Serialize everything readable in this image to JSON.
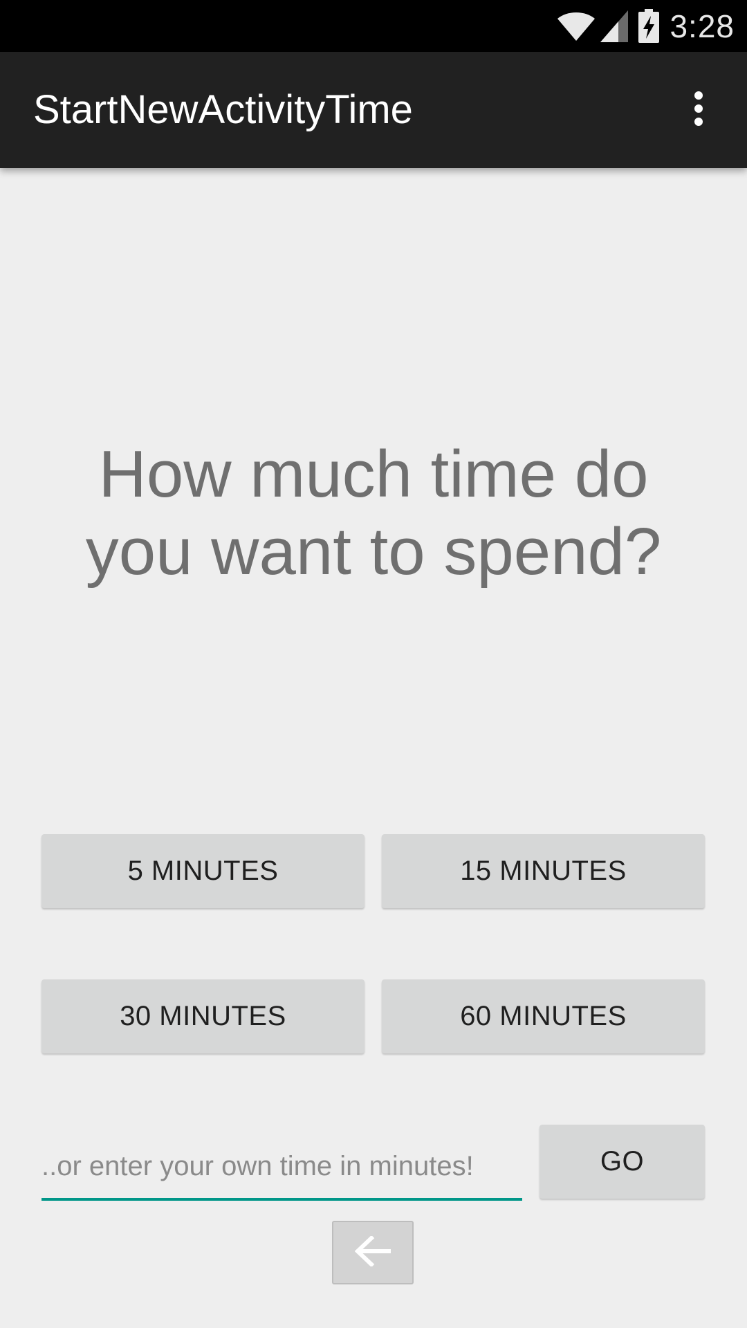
{
  "status_bar": {
    "time": "3:28",
    "icons": [
      "wifi-icon",
      "cell-signal-icon",
      "battery-charging-icon"
    ],
    "background": "#000000"
  },
  "app_bar": {
    "title": "StartNewActivityTime",
    "overflow_icon": "more-vert-icon",
    "background": "#212121"
  },
  "main": {
    "question": "How much time do you want to spend?",
    "buttons": {
      "five": "5 MINUTES",
      "fifteen": "15 MINUTES",
      "thirty": "30 MINUTES",
      "sixty": "60 MINUTES"
    },
    "custom_time": {
      "placeholder": "..or enter your own time in minutes!",
      "value": "",
      "go_label": "GO"
    },
    "back_icon": "arrow-back-icon"
  },
  "colors": {
    "background": "#eeeeee",
    "button": "#d6d7d7",
    "accent": "#009688",
    "question_text": "#6f6f6f"
  }
}
